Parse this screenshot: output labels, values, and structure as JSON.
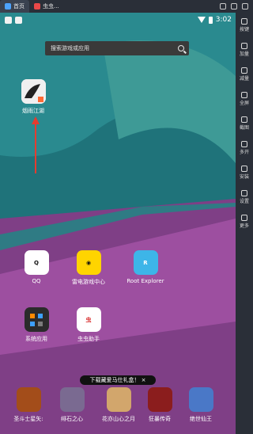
{
  "tabs": {
    "home": "首页",
    "app": "虫虫..."
  },
  "status": {
    "time": "3:02"
  },
  "search": {
    "placeholder": "搜索游戏或应用"
  },
  "apps": {
    "top": "烟雨江湖",
    "qq": "QQ",
    "leidian": "雷电游戏中心",
    "root": "Root Explorer",
    "system": "系统应用",
    "chongchong": "虫虫助手"
  },
  "dock": {
    "banner": "下载藏爱马仕礼盒！ ×",
    "items": [
      "圣斗士星矢:",
      "绯石之心",
      "花亦山心之月",
      "狂暴传奇",
      "绝世仙王"
    ]
  },
  "sidebar": {
    "items": [
      "按键",
      "加量",
      "减量",
      "全屏",
      "截图",
      "多开",
      "安装",
      "设置",
      "更多"
    ]
  }
}
